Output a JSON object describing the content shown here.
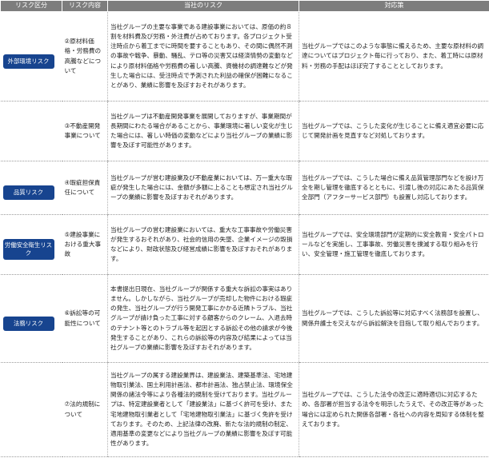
{
  "header": {
    "category": "リスク区分",
    "content": "リスク内容",
    "risk": "当社のリスク",
    "measure": "対応策"
  },
  "rows": [
    {
      "category": "外部環境リスク",
      "content": "②原材料価格・労務費の高騰などについて",
      "risk": "当社グループの主要な事業である建設事業においては、原価の約８割を材料費及び労務・外注費が占めております。各プロジェクト受注時点から着工までに時間を要することもあり、その間に偶然不測の事故や戦争、暴動、騒乱、テロ等の災害又は経済情勢の変動などにより原材料価格や労務費の著しい高騰、資機材の調達難などが発生した場合には、受注時点で予測された利益の確保が困難になることがあり、業績に影響を及ぼすおそれがあります。",
      "measure": "当社グループではこのような事態に備えるため、主要な原材料の調達についてはプロジェクト毎に行っており、また、着工時には原材料・労務の手配はほぼ完了することとしております。"
    },
    {
      "category": "",
      "content": "③不動産開発事業について",
      "risk": "当社グループは不動産開発事業を展開しておりますが、事業期間が長期間にわたる場合があることから、事業環境に著しい変化が生じた場合には、著しい時価の変動などにより当社グループの業績に影響を及ぼす可能性があります。",
      "measure": "当社グループでは、こうした変化が生じることに備え適宜必要に応じて開発計画を見直すなど対処しております。"
    },
    {
      "category": "品質リスク",
      "content": "④瑕疵担保責任について",
      "risk": "当社グループが営む建設業及び不動産業においては、万一重大な瑕疵が発生した場合には、金額が多額に上ることも想定され当社グループの業績に影響を及ぼすおそれがあります。",
      "measure": "当社グループでは、こうした場合に備え品質管理部門などを設け万全を期し管理を徹底するとともに、引渡し後の対応にあたる品質保全部門（アフターサービス部門）も設置し対応しております。"
    },
    {
      "category": "労働安全衛生リスク",
      "content": "⑤建設事業における重大事故",
      "risk": "当社グループの営む建設業においては、重大な工事事故や労働災害が発生するおそれがあり、社会的信用の失墜、企業イメージの毀損などにより、財政状態及び経営成績に影響を及ぼすおそれがあります。",
      "measure": "当社グループでは、安全環境部門が定期的に安全教育・安全パトロールなどを実施し、工事事故、労働災害を撲滅する取り組みを行い、安全管理・施工管理を徹底しております。"
    },
    {
      "category": "法務リスク",
      "content": "⑥訴訟等の可能性について",
      "risk": "本書提出日現在、当社グループが関係する重大な訴訟の事実はありません。しかしながら、当社グループが売却した物件における瑕疵の発生、当社グループが行う開発工事にかかる近隣トラブル、当社グループが請け負った工事に対する顧客からのクレーム、入退去時のテナント等とのトラブル等を起因とする訴訟その他の請求が今後発生することがあり、これらの訴訟等の内容及び結果によっては当社グループの業績に影響を及ぼすおそれがあります。",
      "measure": "当社グループでは、こうした訴訟等に対応すべく法務部を設置し、関係弁護士を交えながら訴訟解決を目指して取り組んでおります。"
    },
    {
      "category": "",
      "content": "⑦法的規制について",
      "risk": "当社グループの属する建設業界は、建設業法、建築基準法、宅地建物取引業法、国土利用計画法、都市計画法、独占禁止法、環境保全関係の諸法令等により各種法的規制を受けております。当社グループは、特定建設業者として「建設業法」に基づく許可を受け、また宅地建物取引業者として「宅地建物取引業法」に基づく免許を受けております。そのため、上記法律の改廃、新たな法的規制の制定、適用基準の変更などにより当社グループの業績に影響を及ぼす可能性があります。",
      "measure": "当社グループでは、こうした法令の改正に適時適切に対応するため、各部署が担当する法令を明示したうえで、その改正等があった場合には定められた関係各部署・各社への内容を周知する体制を整えております。"
    }
  ]
}
